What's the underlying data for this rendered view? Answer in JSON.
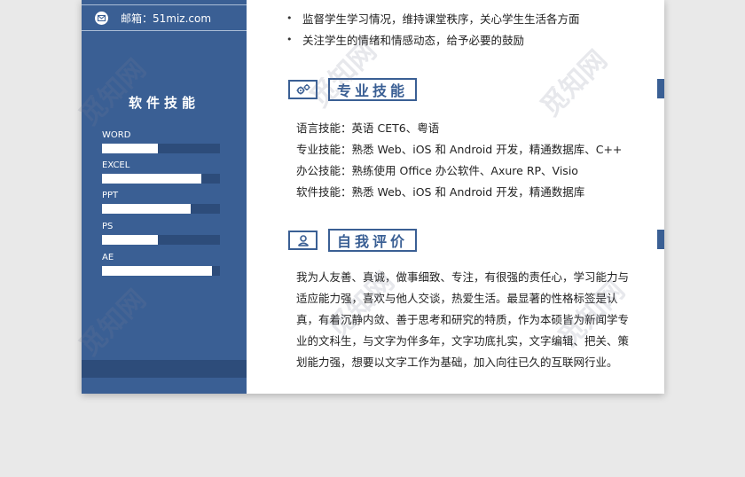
{
  "contact": {
    "email": "邮箱：51miz.com"
  },
  "sidebar": {
    "section_title": "软件技能",
    "skills": [
      {
        "name": "WORD",
        "level": 0.47
      },
      {
        "name": "EXCEL",
        "level": 0.84
      },
      {
        "name": "PPT",
        "level": 0.75
      },
      {
        "name": "PS",
        "level": 0.47
      },
      {
        "name": "AE",
        "level": 0.93
      }
    ]
  },
  "experience": {
    "bullets": [
      "监督学生学习情况，维持课堂秩序，关心学生生活各方面",
      "关注学生的情绪和情感动态，给予必要的鼓励"
    ]
  },
  "professional_skills": {
    "title": "专业技能",
    "icon": "gears-icon",
    "lines": [
      "语言技能：英语 CET6、粤语",
      "专业技能：熟悉 Web、iOS 和 Android 开发，精通数据库、C++",
      "办公技能：熟练使用 Office 办公软件、Axure RP、Visio",
      "软件技能：熟悉 Web、iOS 和 Android 开发，精通数据库"
    ]
  },
  "self_evaluation": {
    "title": "自我评价",
    "icon": "person-icon",
    "text": "我为人友善、真诚，做事细致、专注，有很强的责任心，学习能力与适应能力强，喜欢与他人交谈，热爱生活。最显著的性格标签是认真，有着沉静内敛、善于思考和研究的特质，作为本硕皆为新闻学专业的文科生，与文字为伴多年，文字功底扎实，文字编辑、把关、策划能力强，想要以文字工作为基础，加入向往已久的互联网行业。"
  },
  "watermark": "觅知网",
  "colors": {
    "primary": "#3a5f94",
    "dark": "#2d4c7a",
    "background": "#e9e9e9"
  }
}
